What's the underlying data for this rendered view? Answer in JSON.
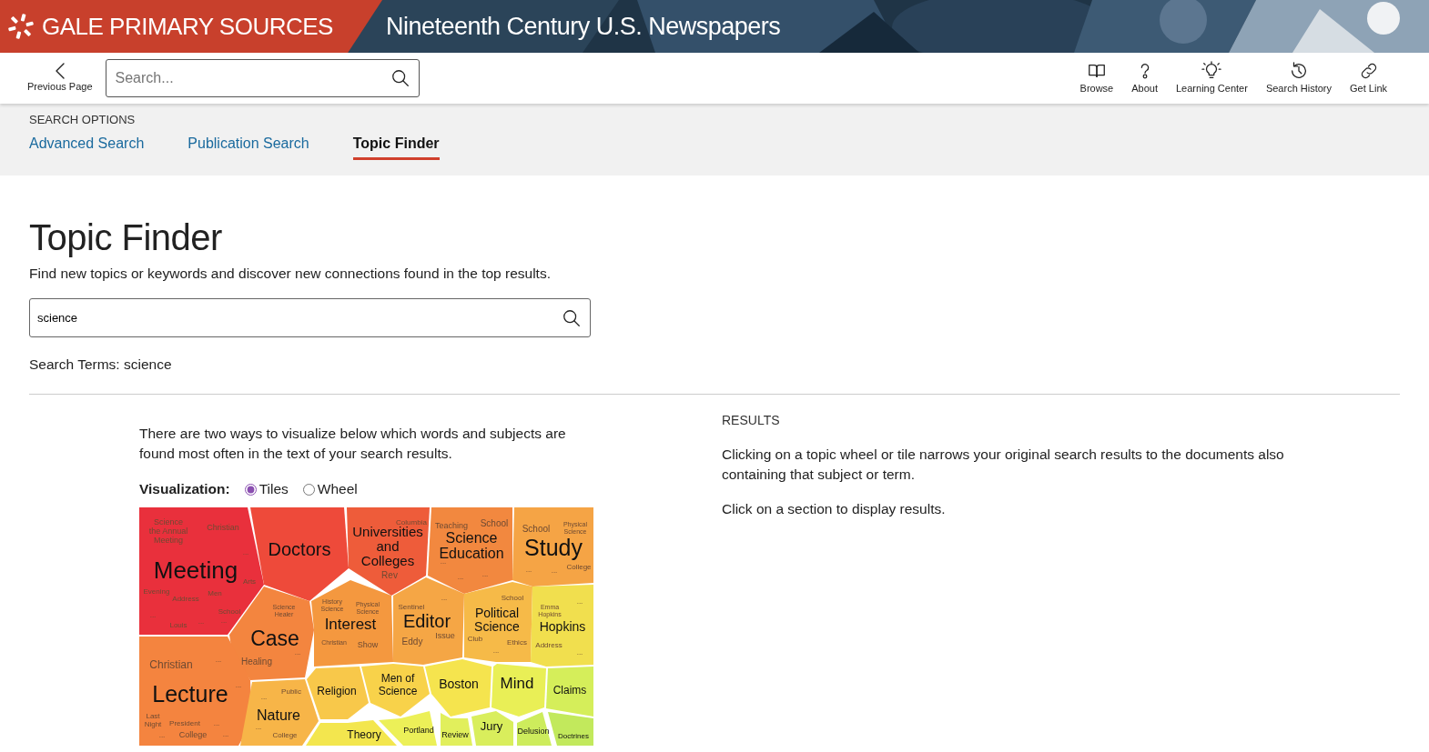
{
  "header": {
    "brand": "GALE PRIMARY SOURCES",
    "title": "Nineteenth Century U.S. Newspapers"
  },
  "toolbar": {
    "back": {
      "label": "Previous Page"
    },
    "search": {
      "placeholder": "Search..."
    },
    "tools": [
      {
        "label": "Browse",
        "kind": "book"
      },
      {
        "label": "About",
        "kind": "question"
      },
      {
        "label": "Learning Center",
        "kind": "bulb"
      },
      {
        "label": "Search History",
        "kind": "history"
      },
      {
        "label": "Get Link",
        "kind": "link"
      }
    ]
  },
  "search_options": {
    "heading": "SEARCH OPTIONS",
    "tabs": [
      {
        "label": "Advanced Search",
        "selected": false
      },
      {
        "label": "Publication Search",
        "selected": false
      },
      {
        "label": "Topic Finder",
        "selected": true
      }
    ]
  },
  "page": {
    "title": "Topic Finder",
    "subtitle": "Find new topics or keywords and discover new connections found in the top results.",
    "search": {
      "value": "science"
    },
    "search_terms": "Search Terms: science"
  },
  "visualization": {
    "intro": "There are two ways to visualize below which words and subjects are found most often in the text of your search results.",
    "label": "Visualization:",
    "options": [
      {
        "label": "Tiles",
        "selected": true
      },
      {
        "label": "Wheel",
        "selected": false
      }
    ],
    "tiles": [
      {
        "label": "Meeting",
        "color": "#e9303c",
        "sublabels": [
          "Science the Annual Meeting",
          "Christian",
          "...",
          "Evening",
          "Address",
          "Men",
          "Arts",
          "School",
          "...",
          "Louis",
          "...",
          "..."
        ]
      },
      {
        "label": "Doctors",
        "color": "#ee4a3a"
      },
      {
        "label": "Universities and Colleges",
        "color": "#ee5c3a",
        "sublabels": [
          "Columbia",
          "Rev"
        ]
      },
      {
        "label": "Science Education",
        "color": "#f2883f",
        "sublabels": [
          "Teaching",
          "School",
          "...",
          "...",
          "..."
        ]
      },
      {
        "label": "Study",
        "color": "#f5a445",
        "sublabels": [
          "School",
          "Physical Science",
          "...",
          "...",
          "College"
        ]
      },
      {
        "label": "Case",
        "color": "#f3853f",
        "sublabels": [
          "Science Healer",
          "Healing",
          "..."
        ]
      },
      {
        "label": "Interest",
        "color": "#f4983f",
        "sublabels": [
          "History Science",
          "Physical Science",
          "Christian",
          "Show"
        ]
      },
      {
        "label": "Editor",
        "color": "#f5a645",
        "sublabels": [
          "Sentinel",
          "...",
          "Eddy",
          "Issue"
        ]
      },
      {
        "label": "Political Science",
        "color": "#f6ba48",
        "sublabels": [
          "School",
          "Club",
          "Ethics",
          "..."
        ]
      },
      {
        "label": "Hopkins",
        "color": "#f1df4e",
        "sublabels": [
          "Emma Hopkins",
          "...",
          "Address",
          "..."
        ]
      },
      {
        "label": "Lecture",
        "color": "#f4843f",
        "sublabels": [
          "Christian",
          "...",
          "...",
          "Last Night",
          "President",
          "...",
          "...",
          "College",
          "..."
        ]
      },
      {
        "label": "Nature",
        "color": "#f7b548",
        "sublabels": [
          "...",
          "Public",
          "...",
          "College"
        ]
      },
      {
        "label": "Religion",
        "color": "#f8c84a"
      },
      {
        "label": "Men of Science",
        "color": "#f8d24a"
      },
      {
        "label": "Boston",
        "color": "#f5e44e"
      },
      {
        "label": "Mind",
        "color": "#e9ef56"
      },
      {
        "label": "Claims",
        "color": "#d5ee5a"
      },
      {
        "label": "Theory",
        "color": "#f3e64e"
      },
      {
        "label": "Portland",
        "color": "#ecf058"
      },
      {
        "label": "Review",
        "color": "#e1ef5c"
      },
      {
        "label": "Jury",
        "color": "#d9ee5c"
      },
      {
        "label": "Delusion",
        "color": "#cdec5c"
      },
      {
        "label": "Doctrines",
        "color": "#c2e95c"
      }
    ]
  },
  "results": {
    "heading": "RESULTS",
    "paragraphs": [
      "Clicking on a topic wheel or tile narrows your original search results to the documents also containing that subject or term.",
      "Click on a section to display results."
    ]
  }
}
